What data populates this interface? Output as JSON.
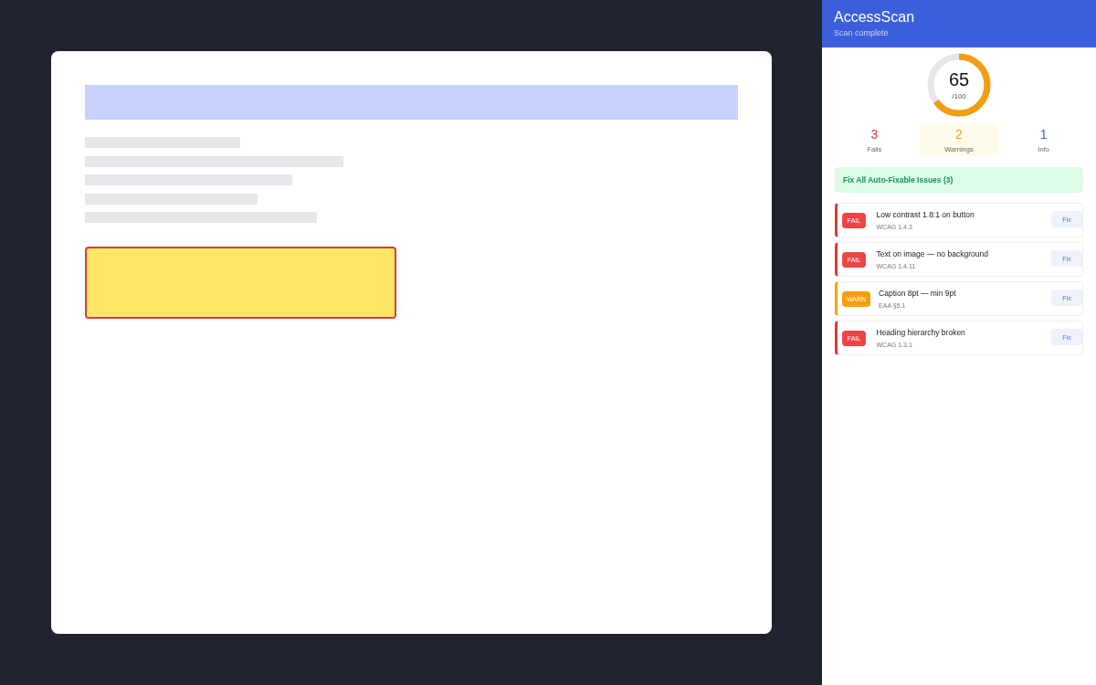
{
  "panel": {
    "title": "AccessScan",
    "subtitle": "Scan complete"
  },
  "score": {
    "value": "65",
    "max": "/100",
    "level": 0.65
  },
  "stats": [
    {
      "count": "3",
      "label": "Fails",
      "color": "#dc3c3c",
      "selected": false
    },
    {
      "count": "2",
      "label": "Warnings",
      "color": "#f59e0b",
      "selected": true
    },
    {
      "count": "1",
      "label": "Info",
      "color": "#3b5bdb",
      "selected": false
    }
  ],
  "fix_all": "Fix All Auto-Fixable Issues (3)",
  "issues": [
    {
      "kind": "fail",
      "badge": "FAIL",
      "title": "Low contrast 1.8:1 on button",
      "rule": "WCAG 1.4.3",
      "action": "Fix"
    },
    {
      "kind": "fail",
      "badge": "FAIL",
      "title": "Text on image — no background",
      "rule": "WCAG 1.4.11",
      "action": "Fix"
    },
    {
      "kind": "warn",
      "badge": "WARN",
      "title": "Caption 8pt — min 9pt",
      "rule": "EAA §5.1",
      "action": "Fix"
    },
    {
      "kind": "fail",
      "badge": "FAIL",
      "title": "Heading hierarchy broken",
      "rule": "WCAG 1.3.1",
      "action": "Fix"
    }
  ]
}
